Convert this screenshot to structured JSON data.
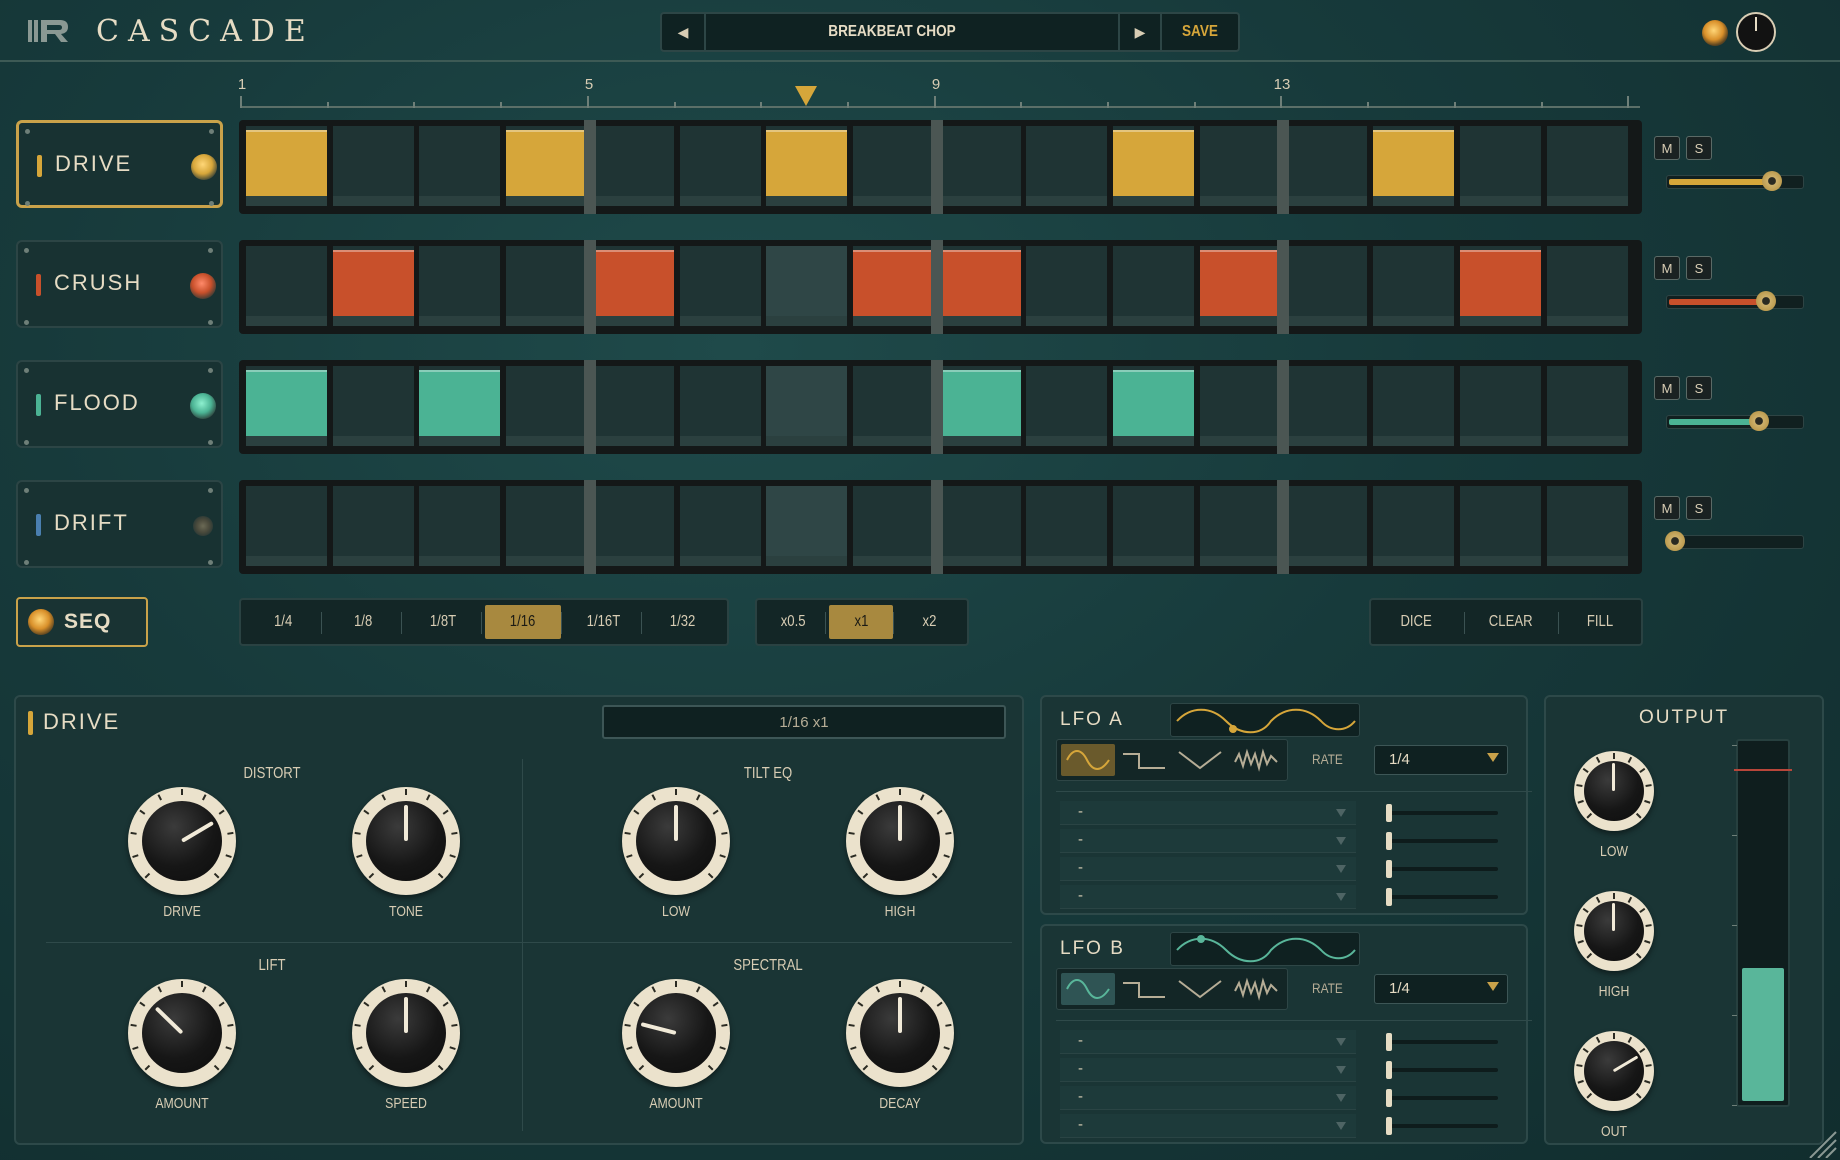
{
  "app": {
    "title": "CASCADE"
  },
  "preset": {
    "name": "BREAKBEAT CHOP",
    "prev_icon": "triangle-left",
    "next_icon": "triangle-right",
    "save_label": "SAVE"
  },
  "header_controls": {
    "power_led": "led-icon",
    "master_knob": "knob"
  },
  "ruler": {
    "labels": [
      {
        "text": "1"
      },
      {
        "text": "5"
      },
      {
        "text": "9"
      },
      {
        "text": "13"
      }
    ],
    "steps": 16,
    "playhead_step": 7
  },
  "tracks": [
    {
      "name": "DRIVE",
      "color": "#d6a63a",
      "active": true,
      "steps": [
        1,
        0,
        0,
        1,
        0,
        0,
        1,
        0,
        0,
        0,
        1,
        0,
        0,
        1,
        0,
        0
      ],
      "volume": 0.82,
      "mute": "M",
      "solo": "S"
    },
    {
      "name": "CRUSH",
      "color": "#c8502b",
      "active": false,
      "steps": [
        0,
        1,
        0,
        0,
        1,
        0,
        0,
        1,
        1,
        0,
        0,
        1,
        0,
        0,
        1,
        0
      ],
      "volume": 0.77,
      "mute": "M",
      "solo": "S"
    },
    {
      "name": "FLOOD",
      "color": "#4bb394",
      "active": false,
      "steps": [
        1,
        0,
        1,
        0,
        0,
        0,
        0,
        0,
        1,
        0,
        1,
        0,
        0,
        0,
        0,
        0
      ],
      "volume": 0.72,
      "mute": "M",
      "solo": "S"
    },
    {
      "name": "DRIFT",
      "color": "#4a7fb0",
      "active": false,
      "steps": [
        0,
        0,
        0,
        0,
        0,
        0,
        0,
        0,
        0,
        0,
        0,
        0,
        0,
        0,
        0,
        0
      ],
      "volume": 0.0,
      "mute": "M",
      "solo": "S"
    }
  ],
  "seq": {
    "label": "SEQ"
  },
  "division": {
    "options": [
      "1/4",
      "1/8",
      "1/8T",
      "1/16",
      "1/16T",
      "1/32"
    ],
    "selected": "1/16"
  },
  "multiplier": {
    "options": [
      "x0.5",
      "x1",
      "x2"
    ],
    "selected": "x1"
  },
  "pattern_actions": {
    "dice": "DICE",
    "clear": "CLEAR",
    "fill": "FILL"
  },
  "drive_panel": {
    "title": "DRIVE",
    "rate_display": "1/16 x1",
    "sections": [
      {
        "title": "DISTORT",
        "knobs": [
          {
            "label": "DRIVE",
            "value": 0.72
          },
          {
            "label": "TONE",
            "value": 0.5
          }
        ]
      },
      {
        "title": "TILT EQ",
        "knobs": [
          {
            "label": "LOW",
            "value": 0.5
          },
          {
            "label": "HIGH",
            "value": 0.5
          }
        ]
      },
      {
        "title": "LIFT",
        "knobs": [
          {
            "label": "AMOUNT",
            "value": 0.33
          },
          {
            "label": "SPEED",
            "value": 0.5
          }
        ]
      },
      {
        "title": "SPECTRAL",
        "knobs": [
          {
            "label": "AMOUNT",
            "value": 0.22
          },
          {
            "label": "DECAY",
            "value": 0.5
          }
        ]
      }
    ]
  },
  "lfo_a": {
    "title": "LFO A",
    "wave_color": "#d6a63a",
    "shapes": [
      "sine-icon",
      "square-icon",
      "triangle-icon",
      "random-icon"
    ],
    "selected_shape": 0,
    "rate_label": "RATE",
    "rate": "1/4",
    "destinations": [
      {
        "value": "-",
        "amount": 0.0
      },
      {
        "value": "-",
        "amount": 0.0
      },
      {
        "value": "-",
        "amount": 0.0
      },
      {
        "value": "-",
        "amount": 0.0
      }
    ]
  },
  "lfo_b": {
    "title": "LFO B",
    "wave_color": "#59b69a",
    "shapes": [
      "sine-icon",
      "square-icon",
      "triangle-icon",
      "random-icon"
    ],
    "selected_shape": 0,
    "rate_label": "RATE",
    "rate": "1/4",
    "destinations": [
      {
        "value": "-",
        "amount": 0.0
      },
      {
        "value": "-",
        "amount": 0.0
      },
      {
        "value": "-",
        "amount": 0.0
      },
      {
        "value": "-",
        "amount": 0.0
      }
    ]
  },
  "output": {
    "title": "OUTPUT",
    "knobs": [
      {
        "label": "LOW",
        "value": 0.5
      },
      {
        "label": "HIGH",
        "value": 0.5
      },
      {
        "label": "OUT",
        "value": 0.72
      }
    ],
    "meter_level": 0.37,
    "meter_color": "#59b69a",
    "clip_color": "#b8463a"
  }
}
